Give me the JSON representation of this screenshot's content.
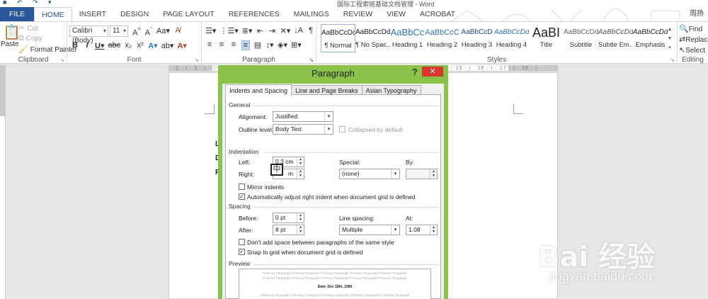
{
  "window": {
    "title": "国际工程索赔基础文档管理 - Word",
    "user": "周扬"
  },
  "tabs": [
    "FILE",
    "HOME",
    "INSERT",
    "DESIGN",
    "PAGE LAYOUT",
    "REFERENCES",
    "MAILINGS",
    "REVIEW",
    "VIEW",
    "ACROBAT"
  ],
  "ribbon": {
    "clipboard": {
      "label": "Clipboard",
      "paste": "Paste",
      "cut": "Cut",
      "copy": "Copy",
      "format_painter": "Format Painter"
    },
    "font": {
      "label": "Font",
      "font_name": "Calibri (Body)",
      "font_size": "11"
    },
    "paragraph": {
      "label": "Paragraph"
    },
    "styles": {
      "label": "Styles",
      "items": [
        {
          "sample": "AaBbCcDd",
          "name": "¶ Normal"
        },
        {
          "sample": "AaBbCcDd",
          "name": "¶ No Spac..."
        },
        {
          "sample": "AaBbCc",
          "name": "Heading 1"
        },
        {
          "sample": "AaBbCcC",
          "name": "Heading 2"
        },
        {
          "sample": "AaBbCcD",
          "name": "Heading 3"
        },
        {
          "sample": "AaBbCcDd",
          "name": "Heading 4"
        },
        {
          "sample": "AaBI",
          "name": "Title"
        },
        {
          "sample": "AaBbCcDd",
          "name": "Subtitle"
        },
        {
          "sample": "AaBbCcDd",
          "name": "Subtle Em..."
        },
        {
          "sample": "AaBbCcDd",
          "name": "Emphasis"
        }
      ]
    },
    "editing": {
      "label": "Editing",
      "find": "Find",
      "replace": "Replace",
      "select": "Select"
    }
  },
  "document": {
    "letters": [
      "L",
      "D",
      "R"
    ]
  },
  "dialog": {
    "title": "Paragraph",
    "help": "?",
    "close": "✕",
    "tabs": [
      "Indents and Spacing",
      "Line and Page Breaks",
      "Asian Typography"
    ],
    "general": {
      "heading": "General",
      "alignment_label": "Alignment:",
      "alignment_value": "Justified",
      "outline_label": "Outline level:",
      "outline_value": "Body Text",
      "collapsed_label": "Collapsed by default"
    },
    "indentation": {
      "heading": "Indentation",
      "left_label": "Left:",
      "left_value": "0.3 cm",
      "right_label": "Right:",
      "right_value": "m",
      "special_label": "Special:",
      "special_value": "(none)",
      "by_label": "By:",
      "mirror_label": "Mirror indents",
      "auto_adjust_label": "Automatically adjust right indent when document grid is defined"
    },
    "spacing": {
      "heading": "Spacing",
      "before_label": "Before:",
      "before_value": "0 pt",
      "after_label": "After:",
      "after_value": "8 pt",
      "line_spacing_label": "Line spacing:",
      "line_spacing_value": "Multiple",
      "at_label": "At:",
      "at_value": "1.08",
      "dont_add_label": "Don't add space between paragraphs of the same style",
      "snap_label": "Snap to grid when document grid is defined"
    },
    "preview": {
      "heading": "Preview",
      "previous_text": "Previous Paragraph Previous Paragraph Previous Paragraph Previous Paragraph Previous Paragraph",
      "sample_text": "Date: Dec 18th, 1966",
      "following_text": "Following Paragraph Following Paragraph Following Paragraph Following Paragraph Following Paragraph"
    },
    "ime_char": "中"
  },
  "watermark": {
    "brand": "Bai 经验",
    "url": "jingyan.baidu.com"
  }
}
